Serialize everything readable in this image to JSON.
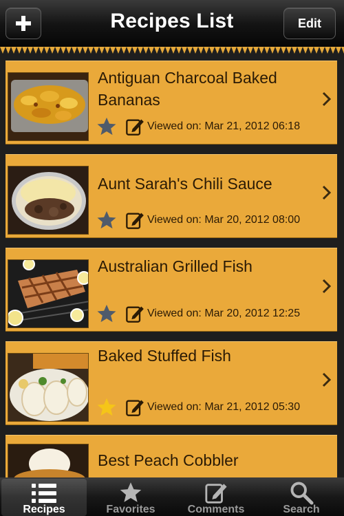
{
  "navbar": {
    "title": "Recipes List",
    "add_icon": "plus-icon",
    "edit_label": "Edit"
  },
  "colors": {
    "row_bg": "#eaa93a",
    "star_favorite": "#f5c518",
    "star_default": "#4f5b6b",
    "text": "#2a1a05"
  },
  "recipes": [
    {
      "title": "Antiguan Charcoal Baked Bananas",
      "favorite": false,
      "viewed": "Viewed on: Mar 21, 2012 06:18"
    },
    {
      "title": "Aunt Sarah's Chili Sauce",
      "favorite": false,
      "viewed": "Viewed on: Mar 20, 2012 08:00"
    },
    {
      "title": "Australian Grilled Fish",
      "favorite": false,
      "viewed": "Viewed on: Mar 20, 2012 12:25"
    },
    {
      "title": "Baked Stuffed Fish",
      "favorite": true,
      "viewed": "Viewed on: Mar 21, 2012 05:30"
    },
    {
      "title": "Best Peach Cobbler",
      "favorite": false,
      "viewed": ""
    }
  ],
  "tabs": [
    {
      "label": "Recipes",
      "icon": "list-icon",
      "selected": true
    },
    {
      "label": "Favorites",
      "icon": "star-icon",
      "selected": false
    },
    {
      "label": "Comments",
      "icon": "note-icon",
      "selected": false
    },
    {
      "label": "Search",
      "icon": "search-icon",
      "selected": false
    }
  ]
}
